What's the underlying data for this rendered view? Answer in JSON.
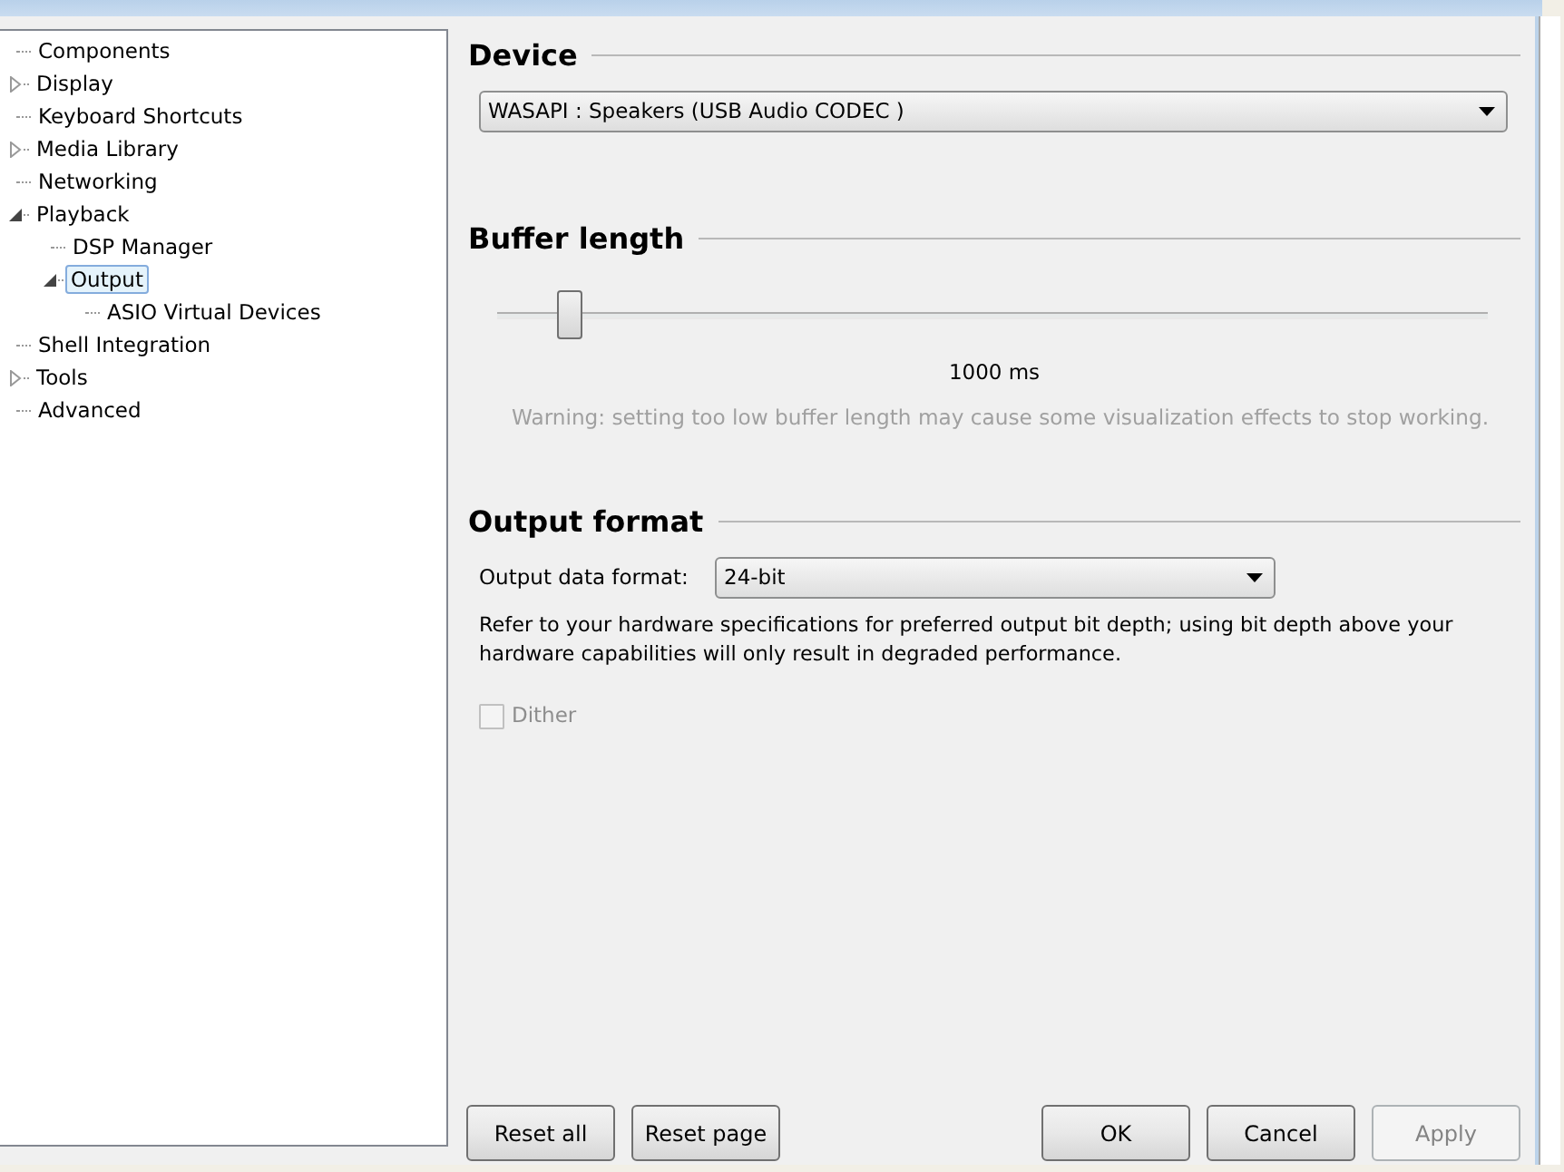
{
  "tree": [
    {
      "label": "Components",
      "selected": false
    },
    {
      "label": "Display",
      "expanded": false,
      "selected": false
    },
    {
      "label": "Keyboard Shortcuts",
      "selected": false
    },
    {
      "label": "Media Library",
      "expanded": false,
      "selected": false
    },
    {
      "label": "Networking",
      "selected": false
    },
    {
      "label": "Playback",
      "expanded": true,
      "selected": false,
      "children": [
        {
          "label": "DSP Manager",
          "selected": false
        },
        {
          "label": "Output",
          "expanded": true,
          "selected": true,
          "children": [
            {
              "label": "ASIO Virtual Devices",
              "selected": false
            }
          ]
        }
      ]
    },
    {
      "label": "Shell Integration",
      "selected": false
    },
    {
      "label": "Tools",
      "expanded": false,
      "selected": false
    },
    {
      "label": "Advanced",
      "selected": false
    }
  ],
  "device": {
    "heading": "Device",
    "value": "WASAPI : Speakers (USB Audio CODEC )"
  },
  "buffer": {
    "heading": "Buffer length",
    "level": 0.06,
    "reading": "1000 ms",
    "warning": "Warning: setting too low buffer length may cause some visualization effects to stop working."
  },
  "output_format": {
    "heading": "Output format",
    "label": "Output data format:",
    "value": "24-bit",
    "note": "Refer to your hardware specifications for preferred output bit depth; using bit depth above your hardware capabilities will only result in degraded performance.",
    "dither": {
      "label": "Dither",
      "checked": false,
      "disabled": true
    }
  },
  "buttons_left": [
    {
      "label": "Reset all",
      "disabled": false
    },
    {
      "label": "Reset page",
      "disabled": false
    }
  ],
  "buttons_right": [
    {
      "label": "OK",
      "disabled": false
    },
    {
      "label": "Cancel",
      "disabled": false
    },
    {
      "label": "Apply",
      "disabled": true
    }
  ]
}
